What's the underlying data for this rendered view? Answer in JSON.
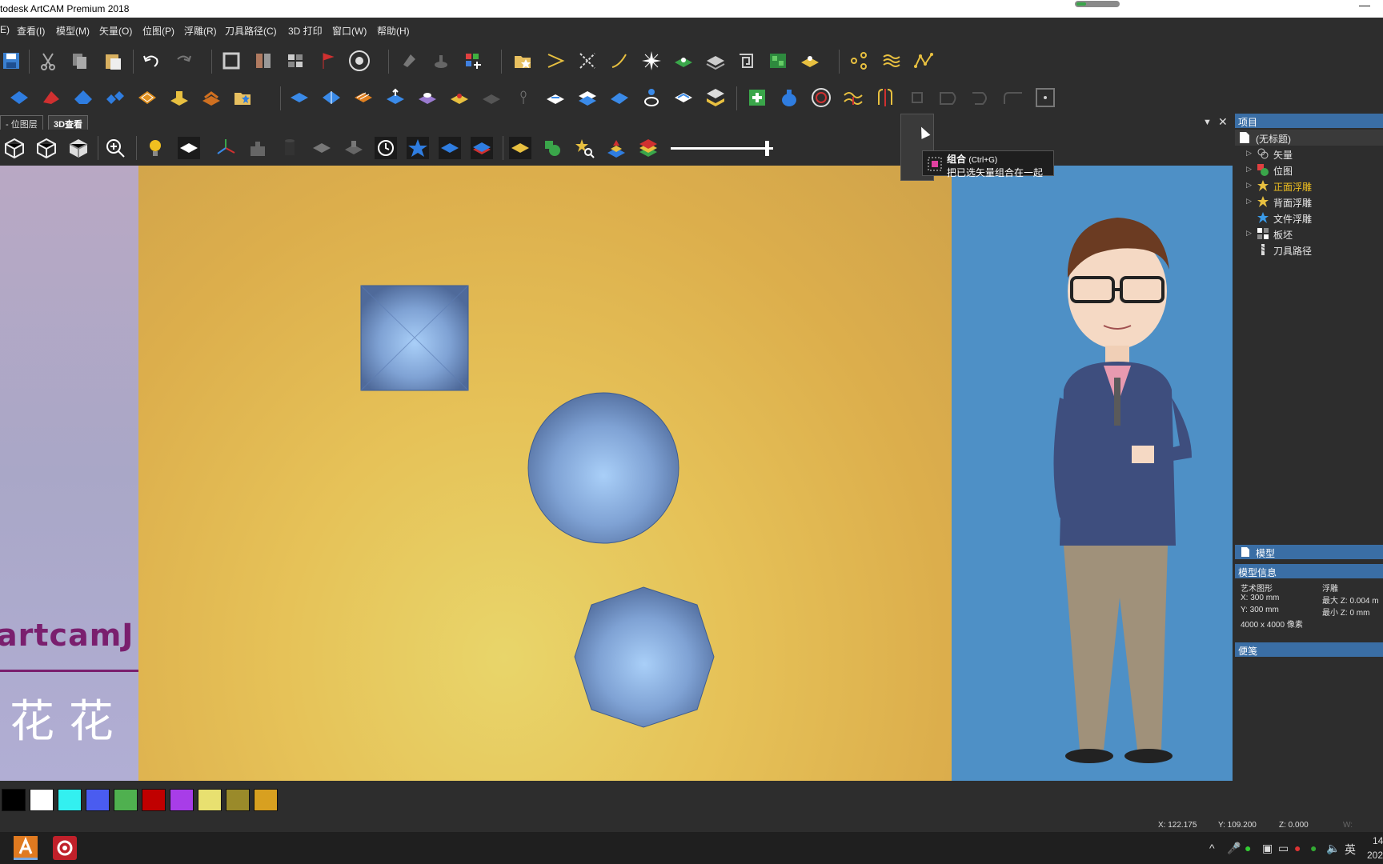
{
  "window": {
    "title": "todesk ArtCAM Premium 2018",
    "minimize": "—"
  },
  "menu": [
    "E)",
    "查看(I)",
    "模型(M)",
    "矢量(O)",
    "位图(P)",
    "浮雕(R)",
    "刀具路径(C)",
    "3D 打印",
    "窗口(W)",
    "帮助(H)"
  ],
  "tabs": {
    "bitmap": "- 位图层",
    "view3d": "3D查看"
  },
  "tooltip": {
    "title": "组合",
    "shortcut": "(Ctrl+G)",
    "description": "把已选矢量组合在一起"
  },
  "project": {
    "header": "项目",
    "root": "(无标题)",
    "items": [
      {
        "label": "矢量",
        "icon": "vector-icon",
        "expandable": true,
        "highlight": false
      },
      {
        "label": "位图",
        "icon": "bitmap-icon",
        "expandable": true,
        "highlight": false
      },
      {
        "label": "正面浮雕",
        "icon": "star-icon",
        "expandable": true,
        "highlight": true
      },
      {
        "label": "背面浮雕",
        "icon": "star-icon",
        "expandable": true,
        "highlight": false
      },
      {
        "label": "文件浮雕",
        "icon": "star-blue-icon",
        "expandable": false,
        "highlight": false
      },
      {
        "label": "板坯",
        "icon": "block-icon",
        "expandable": true,
        "highlight": false
      },
      {
        "label": "刀具路径",
        "icon": "toolpath-icon",
        "expandable": false,
        "highlight": false
      }
    ]
  },
  "model_panel": {
    "header": "模型"
  },
  "model_info": {
    "header": "模型信息",
    "art_label": "艺术图形",
    "relief_label": "浮雕",
    "x": "X: 300 mm",
    "y": "Y: 300 mm",
    "pixels": "4000 x 4000 像素",
    "max_z": "最大 Z: 0.004 m",
    "min_z": "最小 Z: 0 mm"
  },
  "notes": {
    "header": "便笺"
  },
  "left_strip": {
    "brand": "artcamJ",
    "flowers": "花 花 ,"
  },
  "palette": [
    "#000000",
    "#ffffff",
    "#33f0f0",
    "#4a5cf0",
    "#4fb04f",
    "#c00000",
    "#a83de8",
    "#e8e070",
    "#9a8a2a",
    "#d8a020"
  ],
  "status": {
    "x": "X: 122.175",
    "y": "Y: 109.200",
    "z": "Z: 0.000",
    "w": "W:"
  },
  "taskbar": {
    "ime": "英",
    "clock_a": "14",
    "clock_b": "202"
  },
  "colors": {
    "panel_header": "#3a6ea5",
    "viewport_gold": "#e6c258",
    "relief_blue": "#8fb4e8"
  }
}
